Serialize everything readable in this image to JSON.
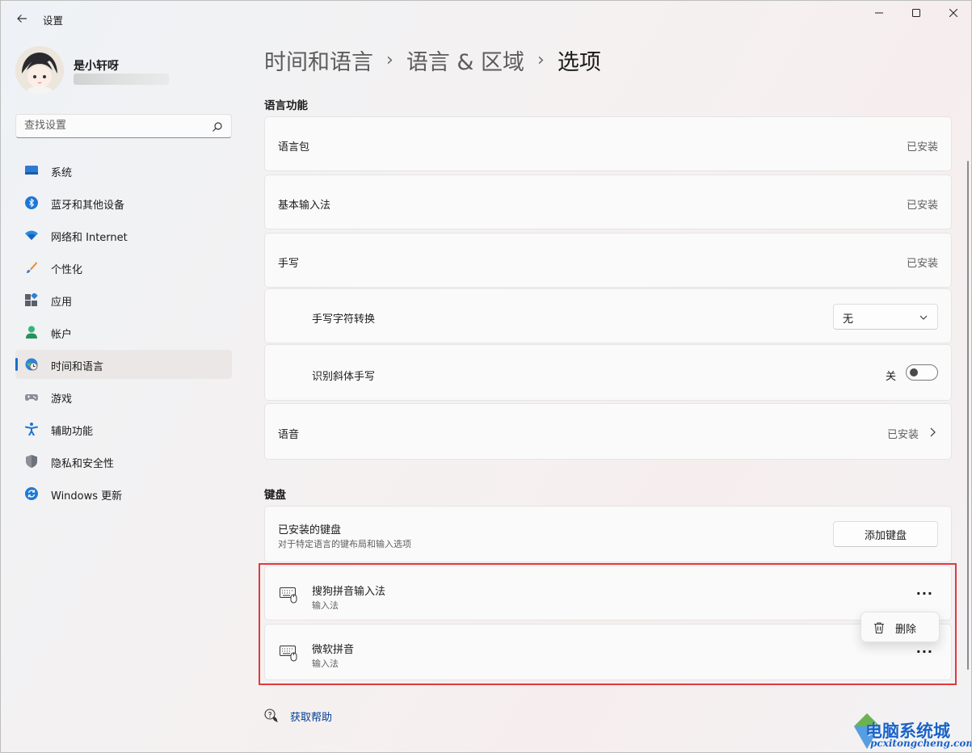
{
  "window": {
    "title": "设置"
  },
  "user": {
    "name": "是小轩呀"
  },
  "search": {
    "placeholder": "查找设置"
  },
  "nav": [
    {
      "label": "系统",
      "icon": "monitor-icon"
    },
    {
      "label": "蓝牙和其他设备",
      "icon": "bluetooth-icon"
    },
    {
      "label": "网络和 Internet",
      "icon": "wifi-icon"
    },
    {
      "label": "个性化",
      "icon": "brush-icon"
    },
    {
      "label": "应用",
      "icon": "apps-icon"
    },
    {
      "label": "帐户",
      "icon": "account-icon"
    },
    {
      "label": "时间和语言",
      "icon": "globe-clock-icon",
      "active": true
    },
    {
      "label": "游戏",
      "icon": "gamepad-icon"
    },
    {
      "label": "辅助功能",
      "icon": "accessibility-icon"
    },
    {
      "label": "隐私和安全性",
      "icon": "shield-icon"
    },
    {
      "label": "Windows 更新",
      "icon": "update-icon"
    }
  ],
  "breadcrumb": [
    "时间和语言",
    "语言 & 区域",
    "选项"
  ],
  "language_features": {
    "title": "语言功能",
    "language_pack": {
      "label": "语言包",
      "status": "已安装"
    },
    "basic_typing": {
      "label": "基本输入法",
      "status": "已安装"
    },
    "handwriting": {
      "label": "手写",
      "status": "已安装"
    },
    "handwriting_conversion": {
      "label": "手写字符转换",
      "value": "无"
    },
    "italic_handwriting": {
      "label": "识别斜体手写",
      "state": "关"
    },
    "speech": {
      "label": "语音",
      "status": "已安装"
    }
  },
  "keyboards": {
    "title": "键盘",
    "installed": {
      "label": "已安装的键盘",
      "description": "对于特定语言的键布局和输入选项",
      "add_button": "添加键盘"
    },
    "items": [
      {
        "name": "搜狗拼音输入法",
        "type": "输入法",
        "more": "···"
      },
      {
        "name": "微软拼音",
        "type": "输入法",
        "more": "···"
      }
    ],
    "context_menu": {
      "delete": "删除"
    }
  },
  "help": {
    "label": "获取帮助"
  },
  "watermark": {
    "title": "电脑系统城",
    "url": "pcxitongcheng.com"
  },
  "colors": {
    "accent": "#1a6fc7",
    "highlight": "#e0393e",
    "link": "#003e92"
  }
}
